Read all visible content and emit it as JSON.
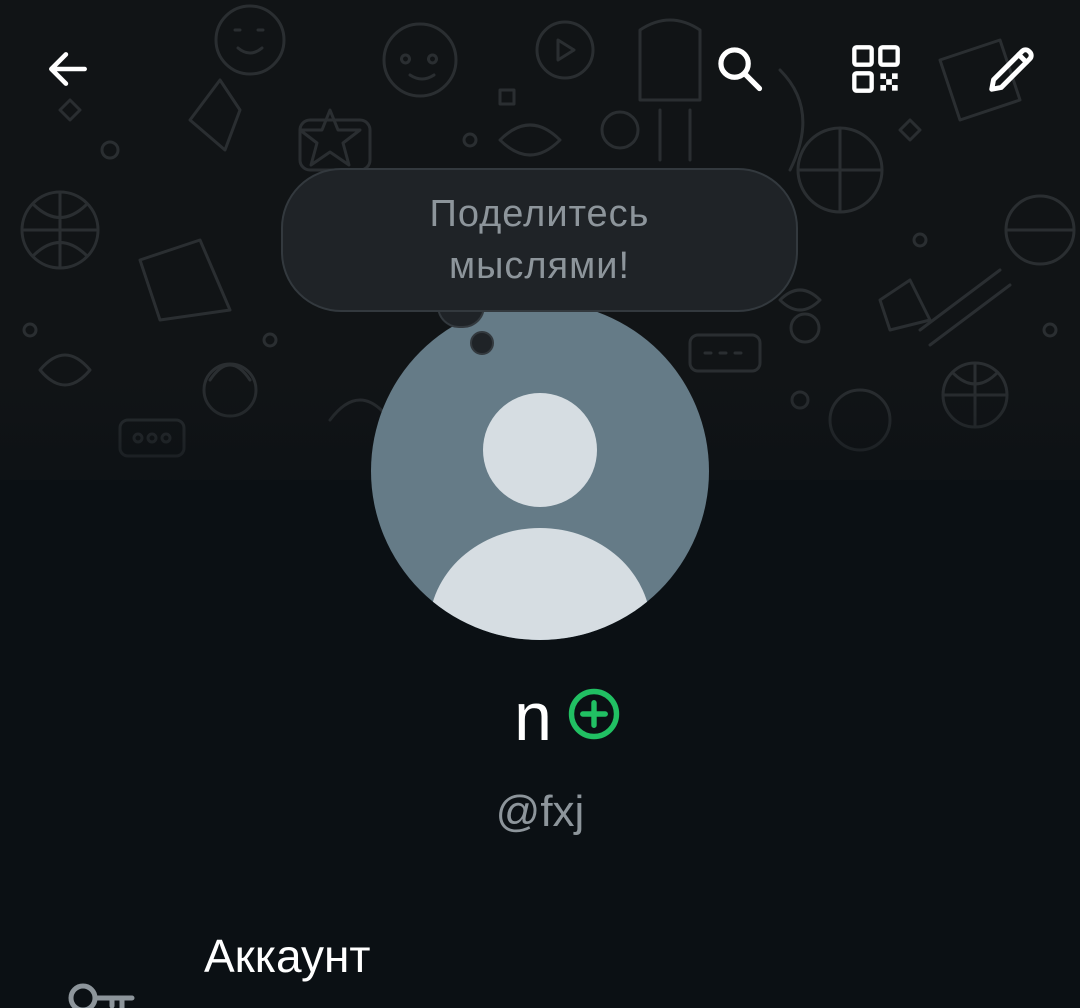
{
  "topbar": {
    "back_icon": "arrow-left-icon",
    "search_icon": "search-icon",
    "qr_icon": "qr-code-icon",
    "edit_icon": "pencil-icon"
  },
  "profile": {
    "status_prompt": "Поделитесь\nмыслями!",
    "name": "n",
    "username": "@fxj",
    "avatar_icon": "default-avatar-icon",
    "add_status_icon": "plus-circle-icon"
  },
  "settings": {
    "items": [
      {
        "label": "Аккаунт",
        "icon": "key-icon"
      }
    ]
  },
  "colors": {
    "background": "#0b1014",
    "header_background": "#111416",
    "accent": "#21c063",
    "avatar_bg": "#657b87",
    "secondary_text": "#8d959b"
  }
}
